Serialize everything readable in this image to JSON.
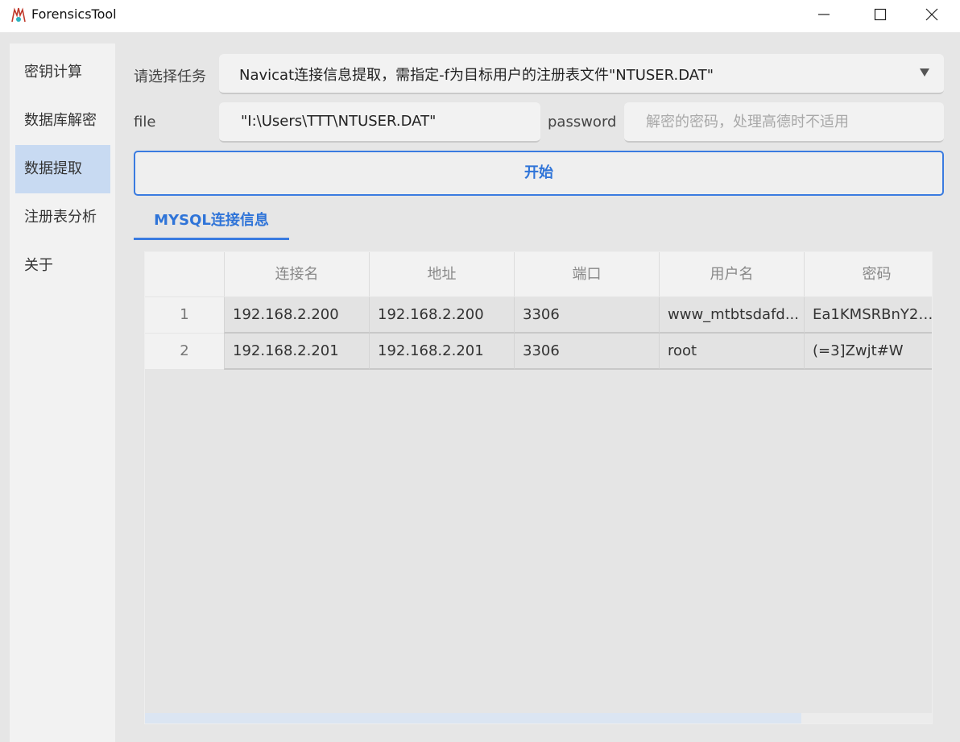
{
  "window": {
    "title": "ForensicsTool",
    "controls": [
      "minimize-icon",
      "maximize-icon",
      "close-icon"
    ]
  },
  "sidebar": {
    "items": [
      {
        "label": "密钥计算"
      },
      {
        "label": "数据库解密"
      },
      {
        "label": "数据提取",
        "active": true
      },
      {
        "label": "注册表分析"
      },
      {
        "label": "关于"
      }
    ]
  },
  "form": {
    "task_label": "请选择任务",
    "task_value": "Navicat连接信息提取，需指定-f为目标用户的注册表文件\"NTUSER.DAT\"",
    "file_label": "file",
    "file_value": "\"I:\\Users\\TTT\\NTUSER.DAT\"",
    "password_label": "password",
    "password_placeholder": "解密的密码，处理高德时不适用",
    "password_value": "",
    "start_label": "开始"
  },
  "tabs": [
    {
      "label": "MYSQL连接信息",
      "active": true
    }
  ],
  "table": {
    "columns": [
      "连接名",
      "地址",
      "端口",
      "用户名",
      "密码"
    ],
    "rows": [
      {
        "index": "1",
        "cells": [
          "192.168.2.200",
          "192.168.2.200",
          "3306",
          "www_mtbtsdafd...",
          "Ea1KMSRBnY2e..."
        ]
      },
      {
        "index": "2",
        "cells": [
          "192.168.2.201",
          "192.168.2.201",
          "3306",
          "root",
          "(=3]Zwjt#W"
        ]
      }
    ]
  },
  "colors": {
    "accent": "#3a7be0",
    "sidebar_active": "#c8daf2"
  }
}
